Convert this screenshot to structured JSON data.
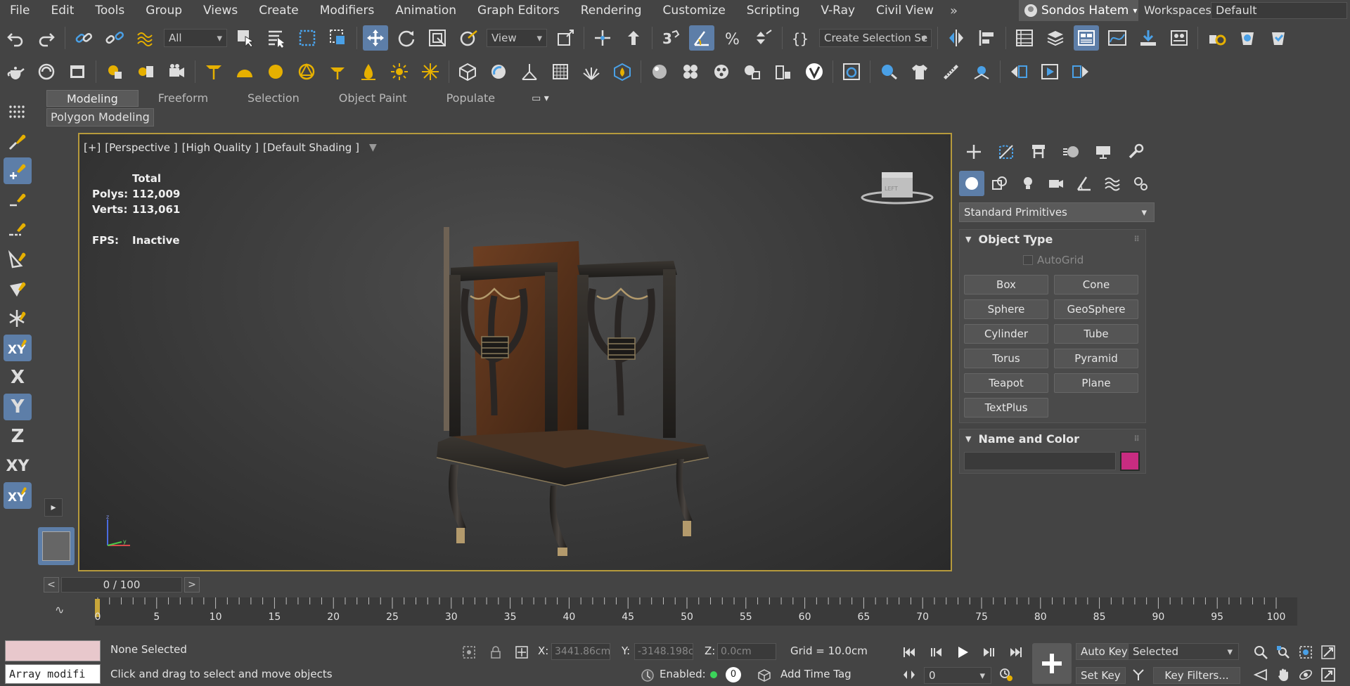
{
  "menu": {
    "items": [
      "File",
      "Edit",
      "Tools",
      "Group",
      "Views",
      "Create",
      "Modifiers",
      "Animation",
      "Graph Editors",
      "Rendering",
      "Customize",
      "Scripting",
      "V-Ray",
      "Civil View"
    ],
    "overflow": "»",
    "user": "Sondos Hatem",
    "workspaces_label": "Workspaces:",
    "workspace": "Default"
  },
  "toolbar": {
    "selection_filter": "All",
    "ref_coord": "View",
    "named_selection_placeholder": "Create Selection Se"
  },
  "ribbon": {
    "tabs": [
      "Modeling",
      "Freeform",
      "Selection",
      "Object Paint",
      "Populate"
    ],
    "active_tab": "Modeling",
    "panel": "Polygon Modeling",
    "menu_icon": "▭"
  },
  "left_toolbar": {
    "axis_labels": [
      "X",
      "Y",
      "Z",
      "XY"
    ],
    "expand_icon": "▸"
  },
  "viewport": {
    "label_parts": [
      "[+]",
      "[Perspective ]",
      "[High Quality ]",
      "[Default Shading ]"
    ],
    "stats": {
      "header": "Total",
      "polys_label": "Polys:",
      "polys": "112,009",
      "verts_label": "Verts:",
      "verts": "113,061",
      "fps_label": "FPS:",
      "fps": "Inactive"
    },
    "border_color": "#b69a3c"
  },
  "command_panel": {
    "dropdown": "Standard Primitives",
    "object_type_title": "Object Type",
    "autogrid": "AutoGrid",
    "primitives": [
      "Box",
      "Cone",
      "Sphere",
      "GeoSphere",
      "Cylinder",
      "Tube",
      "Torus",
      "Pyramid",
      "Teapot",
      "Plane",
      "TextPlus"
    ],
    "name_color_title": "Name and Color",
    "object_color": "#c82c81",
    "active_color": "#5d7ea8"
  },
  "timeline": {
    "frame_display": "0 / 100",
    "prev": "<",
    "next": ">",
    "tick_labels": [
      "0",
      "5",
      "10",
      "15",
      "20",
      "25",
      "30",
      "35",
      "40",
      "45",
      "50",
      "55",
      "60",
      "65",
      "70",
      "75",
      "80",
      "85",
      "90",
      "95",
      "100"
    ]
  },
  "status": {
    "maxscript_line": "Array modifi",
    "selection": "None Selected",
    "prompt": "Click and drag to select and move objects",
    "x_label": "X:",
    "x_value": "3441.86cm",
    "y_label": "Y:",
    "y_value": "-3148.198c",
    "z_label": "Z:",
    "z_value": "0.0cm",
    "grid": "Grid = 10.0cm",
    "enabled_label": "Enabled:",
    "enabled_count": "0",
    "add_time_tag": "Add Time Tag",
    "auto_key": "Auto Key",
    "set_key": "Set Key",
    "key_selection": "Selected",
    "key_filters": "Key Filters...",
    "current_frame": "0"
  }
}
